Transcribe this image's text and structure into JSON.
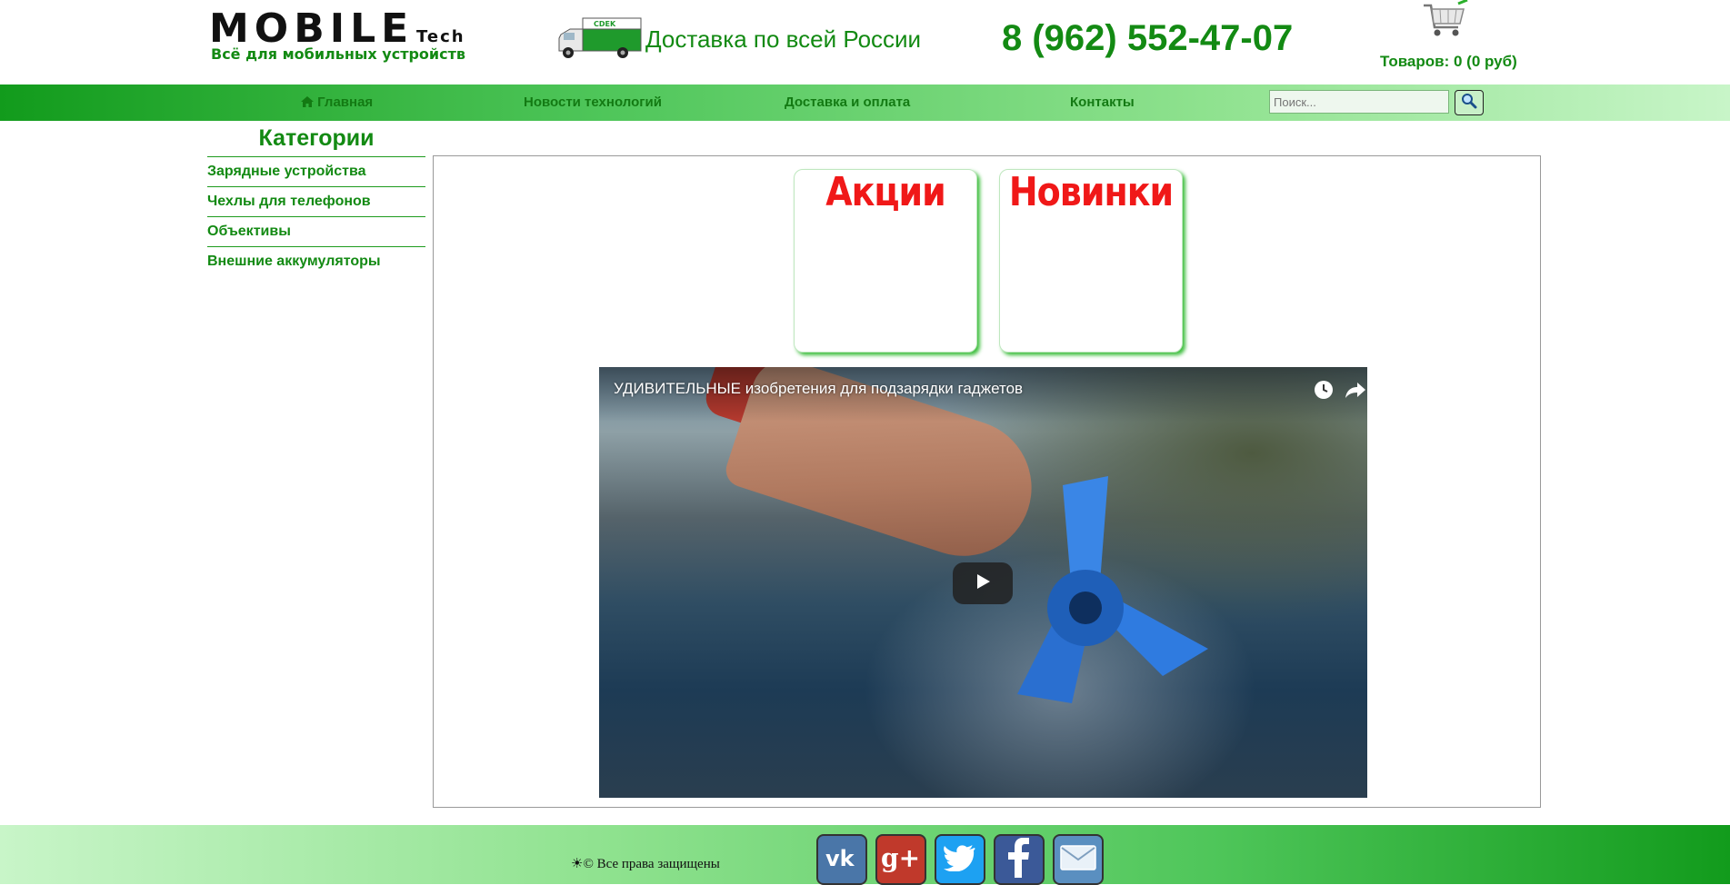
{
  "header": {
    "logo_main": "MOBILE",
    "logo_tech": "Tech",
    "logo_tagline": "Всё для мобильных устройств",
    "delivery_text": "Доставка по всей России",
    "phone": "8 (962) 552-47-07",
    "cart_text": "Товаров: 0 (0 руб)",
    "truck_label": "CDEK",
    "truck_icon": "delivery-truck-icon",
    "cart_icon": "shopping-cart-icon"
  },
  "nav": {
    "items": [
      {
        "label": "Главная",
        "icon": "home-icon"
      },
      {
        "label": "Новости технологий"
      },
      {
        "label": "Доставка и оплата"
      },
      {
        "label": "Контакты"
      }
    ],
    "search_placeholder": "Поиск...",
    "search_icon": "magnifier-icon"
  },
  "sidebar": {
    "title": "Категории",
    "items": [
      {
        "label": "Зарядные устройства"
      },
      {
        "label": "Чехлы для телефонов"
      },
      {
        "label": "Объективы"
      },
      {
        "label": "Внешние аккумуляторы"
      }
    ]
  },
  "main": {
    "promos": [
      {
        "label": "Акции"
      },
      {
        "label": "Новинки"
      }
    ],
    "video": {
      "title": "УДИВИТЕЛЬНЫЕ изобретения для подзарядки гаджетов",
      "icons": [
        "clock-icon",
        "share-icon",
        "play-icon"
      ]
    }
  },
  "footer": {
    "copyright": "☀© Все права защищены",
    "social": [
      {
        "name": "vk",
        "icon": "vk-icon",
        "color": "#4a76a8"
      },
      {
        "name": "google-plus",
        "icon": "google-plus-icon",
        "color": "#c0392b"
      },
      {
        "name": "twitter",
        "icon": "twitter-icon",
        "color": "#1da1f2"
      },
      {
        "name": "facebook",
        "icon": "facebook-icon",
        "color": "#3b5998"
      },
      {
        "name": "email",
        "icon": "mail-icon",
        "color": "#5a8fc0"
      }
    ]
  },
  "colors": {
    "brand_green": "#138a13",
    "promo_red": "#f01818"
  }
}
